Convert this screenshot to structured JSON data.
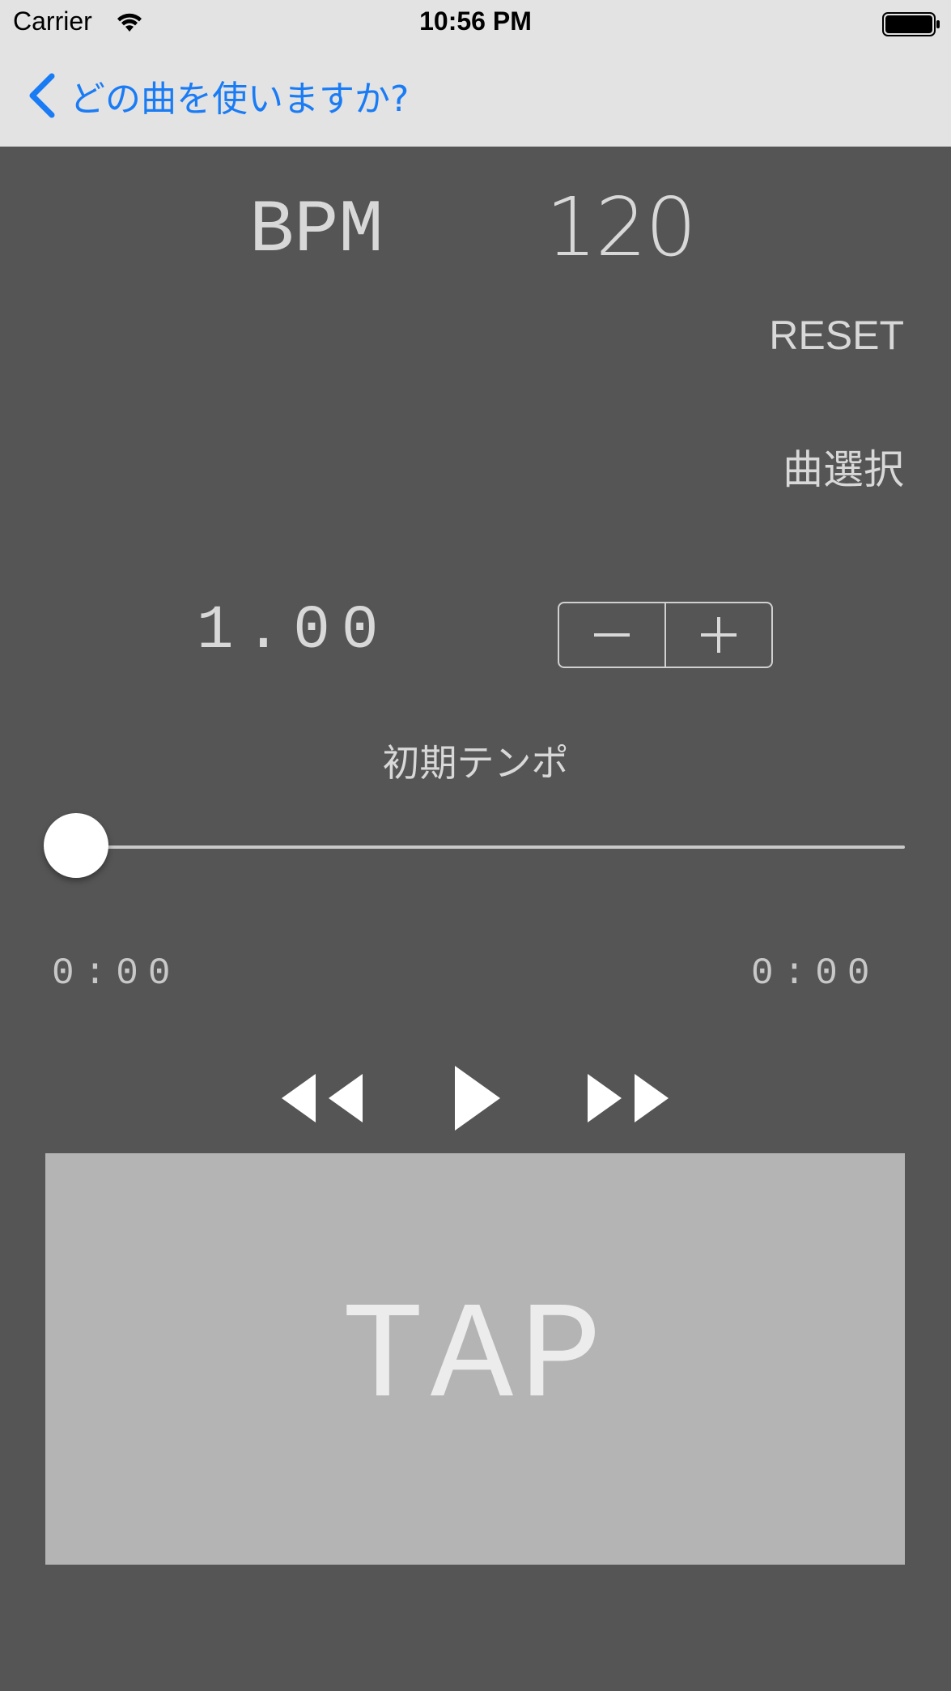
{
  "status_bar": {
    "carrier": "Carrier",
    "time": "10:56 PM"
  },
  "nav": {
    "back_label": "どの曲を使いますか?"
  },
  "bpm": {
    "label": "BPM",
    "value": "120"
  },
  "buttons": {
    "reset": "RESET",
    "song_select": "曲選択"
  },
  "rate": {
    "value": "1.00"
  },
  "tempo_label": "初期テンポ",
  "slider": {
    "position": 0
  },
  "time": {
    "elapsed": "0:00",
    "total": "0:00"
  },
  "tap_label": "TAP",
  "colors": {
    "background": "#555555",
    "bar": "#e3e3e3",
    "accent": "#1a7cf5",
    "text": "#d8d8d8",
    "tap_pad": "#b4b4b4"
  },
  "icons": [
    "wifi-icon",
    "battery-icon",
    "back-chevron-icon",
    "minus-icon",
    "plus-icon",
    "rewind-icon",
    "play-icon",
    "fast-forward-icon"
  ]
}
